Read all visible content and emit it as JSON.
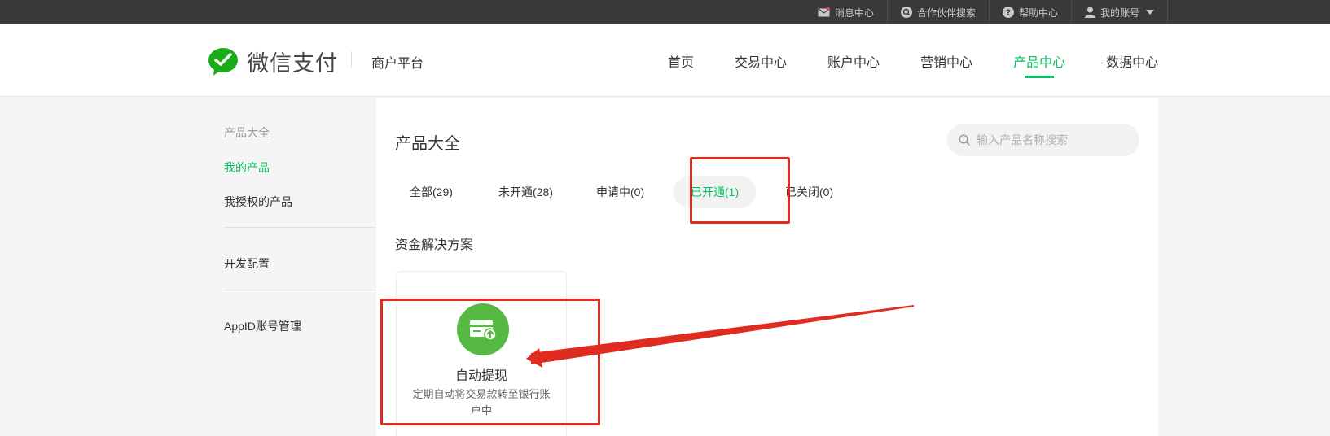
{
  "topbar": {
    "links": [
      {
        "label": "消息中心",
        "icon": "mail-icon"
      },
      {
        "label": "合作伙伴搜索",
        "icon": "partner-search-icon"
      },
      {
        "label": "帮助中心",
        "icon": "help-icon"
      },
      {
        "label": "我的账号",
        "icon": "user-icon"
      }
    ]
  },
  "header": {
    "logo_text": "微信支付",
    "platform": "商户平台",
    "nav": [
      "首页",
      "交易中心",
      "账户中心",
      "营销中心",
      "产品中心",
      "数据中心"
    ],
    "active_nav": "产品中心"
  },
  "sidebar": {
    "section_title": "产品大全",
    "items": [
      "我的产品",
      "我授权的产品",
      "开发配置",
      "AppID账号管理"
    ],
    "active_item": "我的产品"
  },
  "main": {
    "title": "产品大全",
    "search": {
      "placeholder": "输入产品名称搜索",
      "value": ""
    },
    "tabs": [
      "全部(29)",
      "未开通(28)",
      "申请中(0)",
      "已开通(1)",
      "已关闭(0)"
    ],
    "active_tab": "已开通(1)",
    "section_title": "资金解决方案",
    "card": {
      "name": "自动提现",
      "description": "定期自动将交易款转至银行账户中",
      "icon": "bank-card-withdraw-icon"
    }
  },
  "colors": {
    "accent": "#07c160",
    "topbar_bg": "#3a3a3c",
    "card_icon_bg": "#56b944",
    "annotation": "#e02b20"
  }
}
